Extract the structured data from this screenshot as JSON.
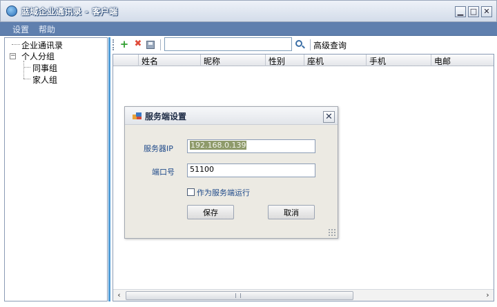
{
  "window": {
    "title": "蓝域企业通讯录 - 客户端",
    "minimize_glyph": "▁",
    "maximize_glyph": "□",
    "close_glyph": "✕"
  },
  "menu": {
    "settings": "设置",
    "help": "帮助"
  },
  "tree": {
    "root": "企业通讯录",
    "group": "个人分组",
    "group_expander": "−",
    "children": [
      "同事组",
      "家人组"
    ]
  },
  "toolbar": {
    "add_glyph": "+",
    "delete_glyph": "✖",
    "search_value": "",
    "advanced_search": "高级查询"
  },
  "grid": {
    "columns": [
      "姓名",
      "昵称",
      "性别",
      "座机",
      "手机",
      "电邮"
    ]
  },
  "scrollbar": {
    "left_glyph": "‹",
    "right_glyph": "›"
  },
  "dialog": {
    "title": "服务端设置",
    "close_glyph": "✕",
    "server_ip_label": "服务器IP",
    "server_ip_value": "192.168.0.139",
    "port_label": "端口号",
    "port_value": "51100",
    "run_as_server_label": "作为服务端运行",
    "run_as_server_checked": false,
    "save_button": "保存",
    "cancel_button": "取消"
  },
  "icons": [
    "app-icon",
    "add-icon",
    "delete-icon",
    "save-icon",
    "search-icon",
    "settings-dialog-icon",
    "close-icon"
  ],
  "colors": {
    "menubar": "#5f7fae",
    "splitter": "#4f9bd6",
    "label_text": "#1f4a8a",
    "ip_selection": "#8e9a6a"
  }
}
